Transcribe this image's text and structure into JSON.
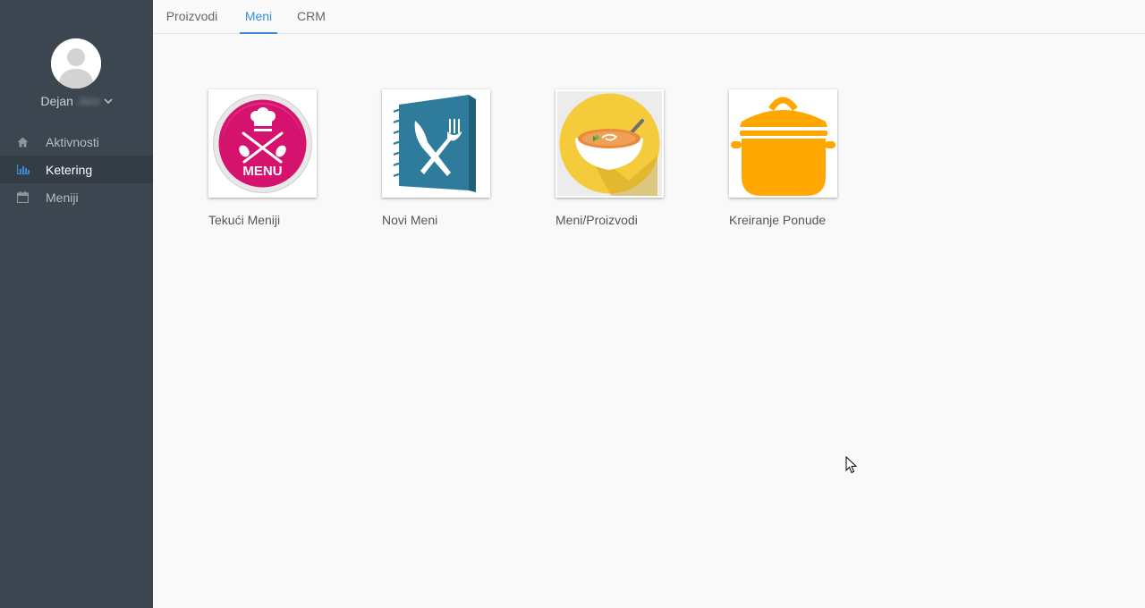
{
  "user": {
    "first_name": "Dejan",
    "last_name": "Jazz"
  },
  "sidebar": {
    "items": [
      {
        "label": "Aktivnosti",
        "icon": "home-icon",
        "active": false
      },
      {
        "label": "Ketering",
        "icon": "bar-chart-icon",
        "active": true
      },
      {
        "label": "Meniji",
        "icon": "calendar-icon",
        "active": false
      }
    ]
  },
  "tabs": [
    {
      "label": "Proizvodi",
      "active": false
    },
    {
      "label": "Meni",
      "active": true
    },
    {
      "label": "CRM",
      "active": false
    }
  ],
  "tiles": [
    {
      "label": "Tekući Meniji",
      "icon": "menu-badge-icon"
    },
    {
      "label": "Novi Meni",
      "icon": "menu-book-icon"
    },
    {
      "label": "Meni/Proizvodi",
      "icon": "soup-bowl-icon"
    },
    {
      "label": "Kreiranje Ponude",
      "icon": "cooking-pot-icon"
    }
  ],
  "badge_text": "MENU",
  "colors": {
    "sidebar": "#3c4650",
    "sidebar_active": "#343d46",
    "accent": "#3a8dd6",
    "menu_badge": "#d6126f",
    "book": "#2e7b9c",
    "soup_bg": "#f4cb3a",
    "pot": "#ffa600"
  }
}
